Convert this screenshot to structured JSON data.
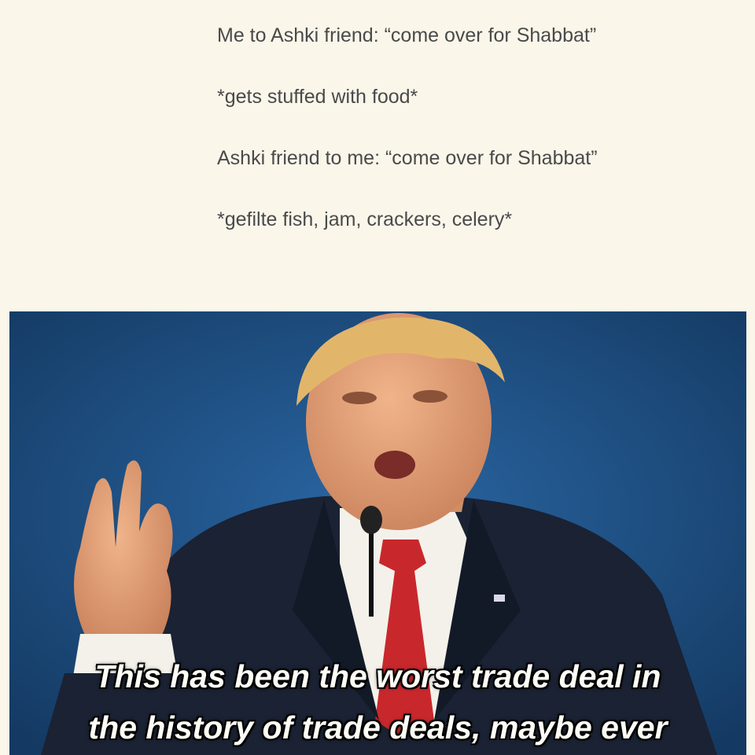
{
  "post": {
    "lines": [
      "Me to Ashki friend: “come over for Shabbat”",
      "*gets stuffed with food*",
      "Ashki friend to me: “come over for Shabbat”",
      "*gefilte fish, jam, crackers, celery*"
    ]
  },
  "meme": {
    "subtitle_line1": "This has been the worst trade deal in",
    "subtitle_line2": "the history of trade deals, maybe ever",
    "background_color": "#1f4f82",
    "suit_color": "#1a2233",
    "tie_color": "#c8282c"
  }
}
